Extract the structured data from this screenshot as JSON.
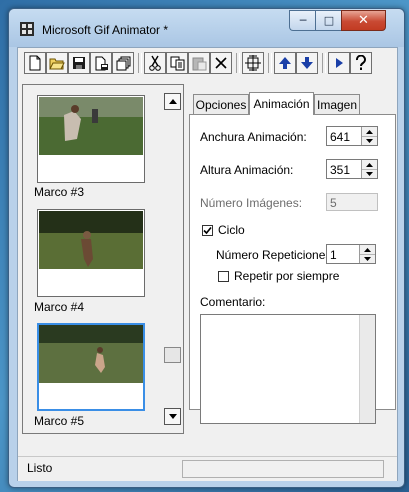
{
  "window": {
    "title": "Microsoft Gif Animator *",
    "minimize_glyph": "─",
    "maximize_glyph": "□",
    "close_glyph": "✕"
  },
  "toolbar": {
    "buttons": [
      "new-icon",
      "open-icon",
      "save-icon",
      "save-as-icon",
      "properties-icon",
      "cut-icon",
      "copy-icon",
      "paste-icon",
      "delete-icon",
      "insert-frame-icon",
      "move-up-icon",
      "move-down-icon",
      "preview-icon",
      "help-icon"
    ]
  },
  "frames": {
    "items": [
      {
        "label": "Marco #3"
      },
      {
        "label": "Marco #4"
      },
      {
        "label": "Marco #5"
      }
    ],
    "selected": "Marco #5"
  },
  "tabs": [
    "Opciones",
    "Animación",
    "Imagen"
  ],
  "active_tab": "Animación",
  "animation": {
    "width_label": "Anchura Animación:",
    "width_value": "641",
    "height_label": "Altura Animación:",
    "height_value": "351",
    "images_label": "Número Imágenes:",
    "images_value": "5",
    "loop_label": "Ciclo",
    "loop_checked": true,
    "repeats_label": "Número Repeticiones:",
    "repeats_value": "1",
    "forever_label": "Repetir por siempre",
    "forever_checked": false,
    "comment_label": "Comentario:",
    "comment_value": ""
  },
  "status": {
    "text": "Listo"
  },
  "colors": {
    "selection": "#3a8ee6",
    "titlebar": "#b9d1ea",
    "close_button": "#c94a33"
  }
}
